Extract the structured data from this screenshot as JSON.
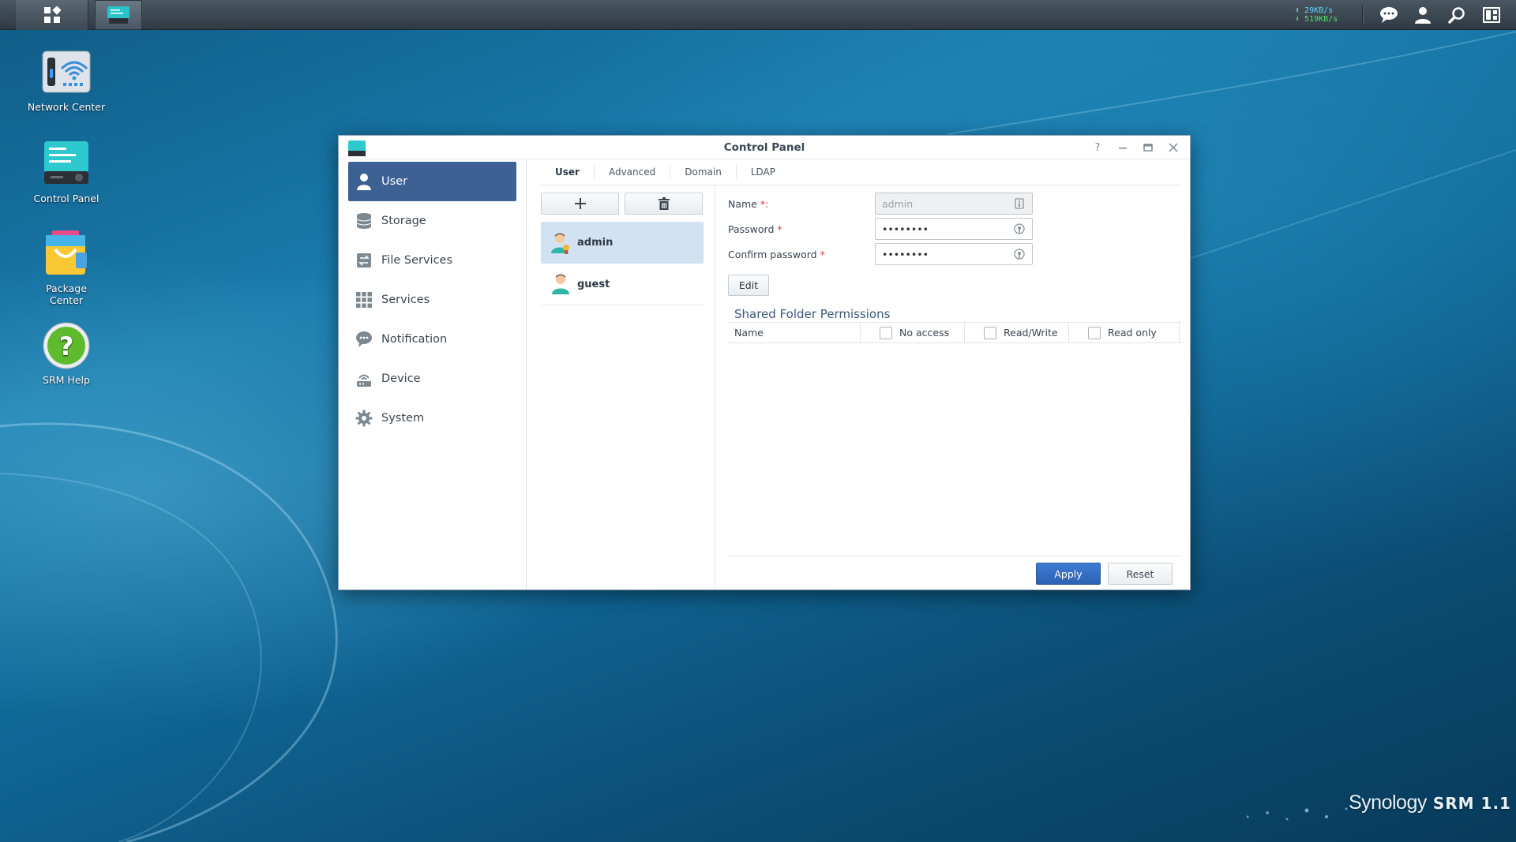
{
  "taskbar": {
    "speed_up": "29KB/s",
    "speed_down": "519KB/s",
    "icons": [
      "main-menu-icon",
      "control-panel-task-icon",
      "notification-chat-icon",
      "user-icon",
      "search-icon",
      "widgets-icon"
    ]
  },
  "desktop": {
    "icons": [
      {
        "label": "Network Center",
        "icon": "network-center-icon"
      },
      {
        "label": "Control Panel",
        "icon": "control-panel-icon"
      },
      {
        "label": "Package Center",
        "icon": "package-center-icon"
      },
      {
        "label": "SRM Help",
        "icon": "help-icon"
      }
    ]
  },
  "window": {
    "title": "Control Panel",
    "sidebar": [
      {
        "label": "User",
        "icon": "user-icon",
        "active": true
      },
      {
        "label": "Storage",
        "icon": "storage-icon"
      },
      {
        "label": "File Services",
        "icon": "file-services-icon"
      },
      {
        "label": "Services",
        "icon": "services-grid-icon"
      },
      {
        "label": "Notification",
        "icon": "notification-icon"
      },
      {
        "label": "Device",
        "icon": "device-icon"
      },
      {
        "label": "System",
        "icon": "gear-icon"
      }
    ],
    "tabs": [
      {
        "label": "User",
        "active": true
      },
      {
        "label": "Advanced"
      },
      {
        "label": "Domain"
      },
      {
        "label": "LDAP"
      }
    ],
    "users": [
      {
        "name": "admin",
        "selected": true
      },
      {
        "name": "guest"
      }
    ],
    "form": {
      "name_label": "Name",
      "name_required": "*:",
      "name_value": "admin",
      "password_label": "Password",
      "password_required": "*",
      "password_value": "••••••••",
      "confirm_label": "Confirm password",
      "confirm_required": "*",
      "confirm_value": "••••••••",
      "edit_button": "Edit"
    },
    "permissions": {
      "title": "Shared Folder Permissions",
      "columns": [
        "Name",
        "No access",
        "Read/Write",
        "Read only"
      ]
    },
    "buttons": {
      "apply": "Apply",
      "reset": "Reset"
    }
  },
  "brand": {
    "name": "Synology",
    "product": "SRM 1.1"
  },
  "colors": {
    "accent": "#3e6194",
    "selected_row": "#d2e2f2",
    "apply": "#2d63b3",
    "speed_up": "#5fd6ff",
    "speed_down": "#55e06a"
  }
}
